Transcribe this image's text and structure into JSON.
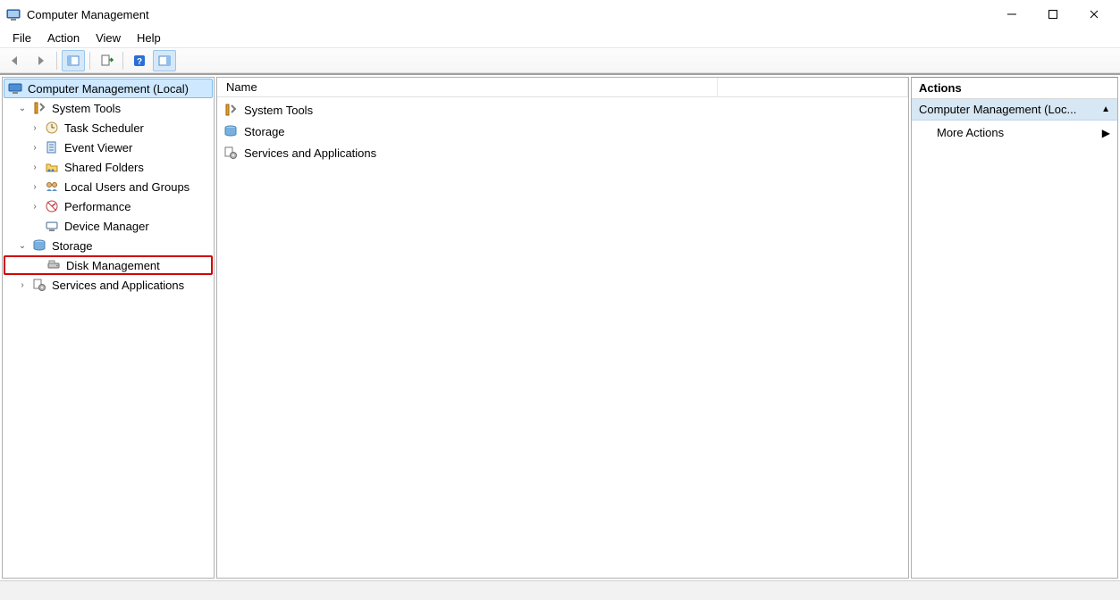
{
  "window": {
    "title": "Computer Management"
  },
  "menu": [
    "File",
    "Action",
    "View",
    "Help"
  ],
  "toolbar": {
    "back": "back-icon",
    "forward": "forward-icon",
    "up": "show-hide-tree-icon",
    "properties": "export-list-icon",
    "help": "help-icon",
    "action_center": "show-hide-action-pane-icon"
  },
  "tree": {
    "root": {
      "label": "Computer Management (Local)",
      "icon": "computer-mgmt-icon",
      "selected": true
    },
    "items": [
      {
        "label": "System Tools",
        "icon": "system-tools-icon",
        "expanded": true,
        "children": [
          {
            "label": "Task Scheduler",
            "icon": "task-scheduler-icon",
            "expandable": true
          },
          {
            "label": "Event Viewer",
            "icon": "event-viewer-icon",
            "expandable": true
          },
          {
            "label": "Shared Folders",
            "icon": "shared-folders-icon",
            "expandable": true
          },
          {
            "label": "Local Users and Groups",
            "icon": "users-groups-icon",
            "expandable": true
          },
          {
            "label": "Performance",
            "icon": "performance-icon",
            "expandable": true
          },
          {
            "label": "Device Manager",
            "icon": "device-manager-icon",
            "expandable": false
          }
        ]
      },
      {
        "label": "Storage",
        "icon": "storage-icon",
        "expanded": true,
        "children": [
          {
            "label": "Disk Management",
            "icon": "disk-mgmt-icon",
            "expandable": false,
            "highlighted": true
          }
        ]
      },
      {
        "label": "Services and Applications",
        "icon": "services-apps-icon",
        "expandable": true
      }
    ]
  },
  "list": {
    "columns": [
      "Name"
    ],
    "rows": [
      {
        "label": "System Tools",
        "icon": "system-tools-icon"
      },
      {
        "label": "Storage",
        "icon": "storage-icon"
      },
      {
        "label": "Services and Applications",
        "icon": "services-apps-icon"
      }
    ]
  },
  "actions": {
    "header": "Actions",
    "group": "Computer Management (Loc...",
    "items": [
      "More Actions"
    ]
  }
}
